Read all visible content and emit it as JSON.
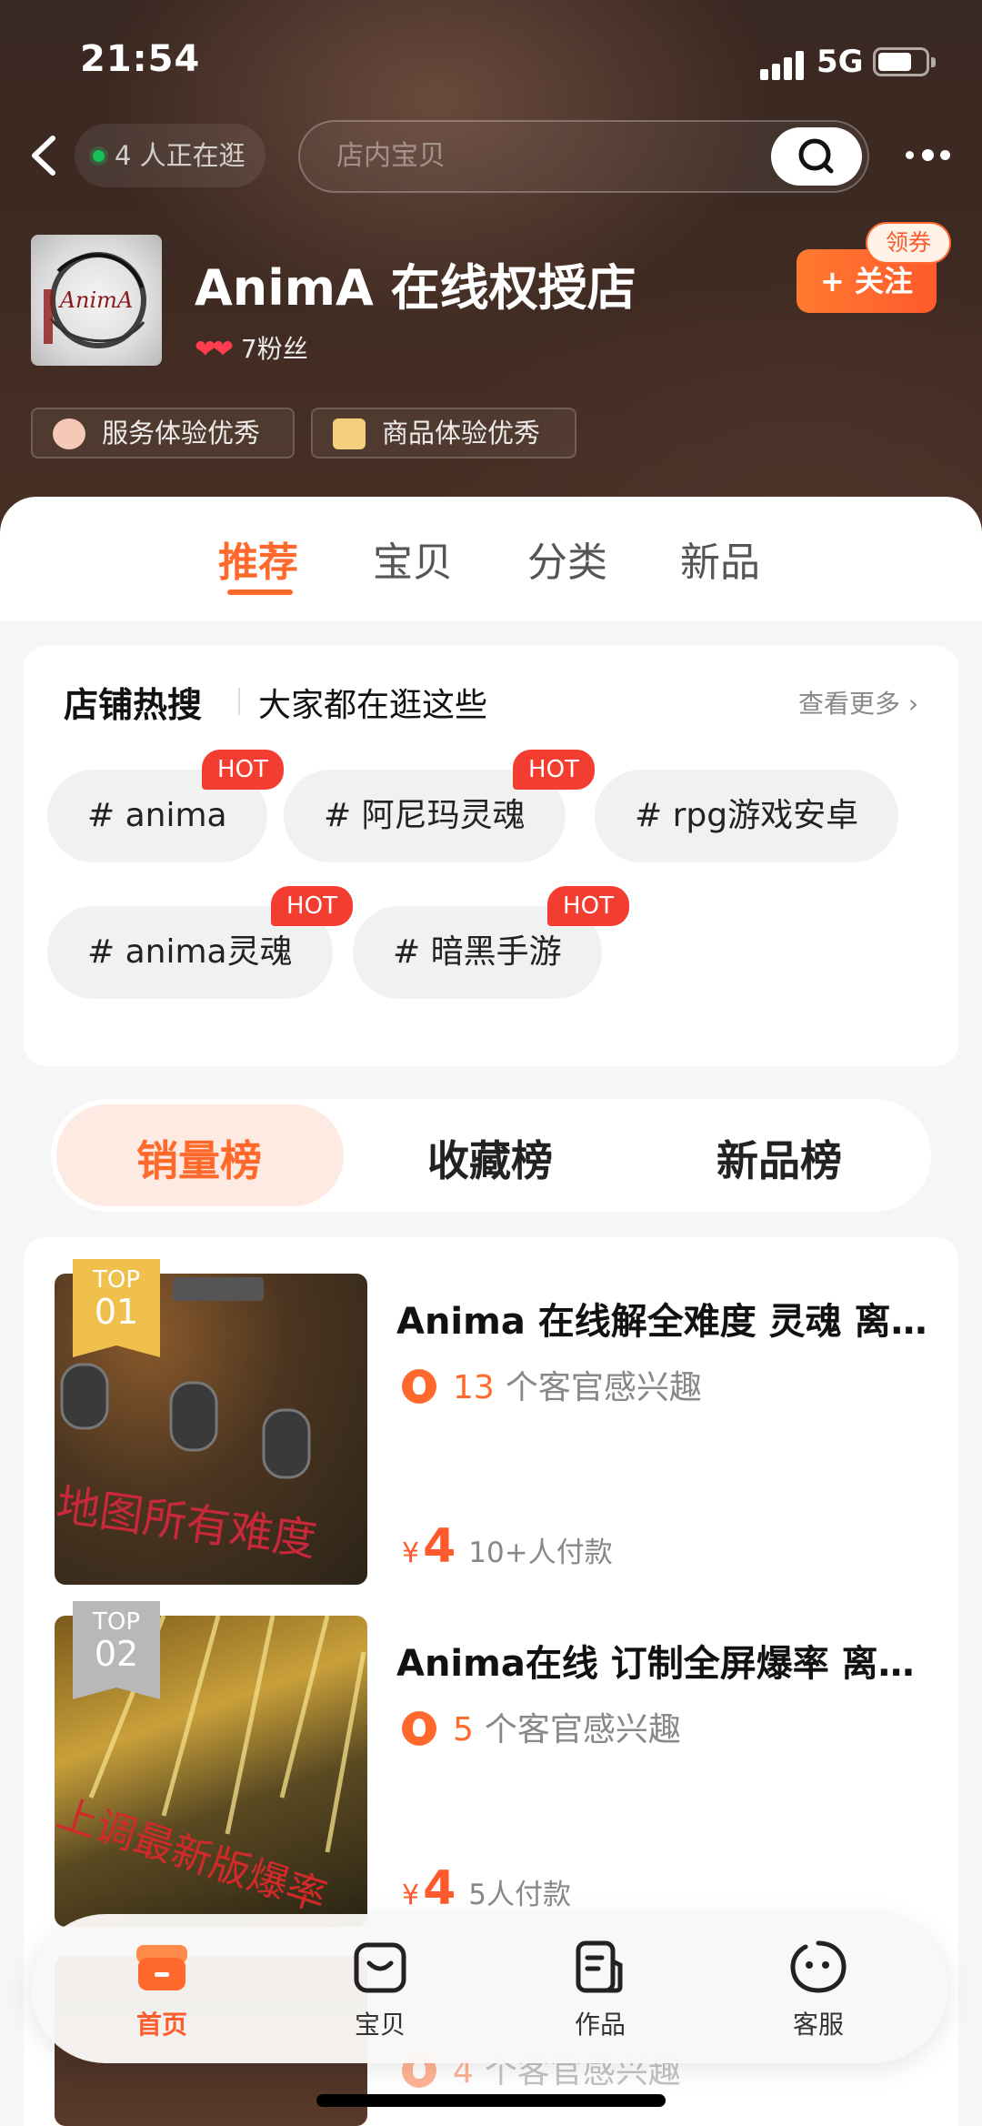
{
  "status_bar": {
    "time": "21:54",
    "network": "5G"
  },
  "header": {
    "browsing_count": "4 人正在逛",
    "search_placeholder": "店内宝贝",
    "logo_text": "AnimA",
    "shop_name": "AnimA 在线权授店",
    "fans": "7粉丝",
    "follow_label": "+ 关注",
    "coupon_label": "领券",
    "badges": [
      "服务体验优秀",
      "商品体验优秀"
    ]
  },
  "tabs": [
    "推荐",
    "宝贝",
    "分类",
    "新品"
  ],
  "hot_search": {
    "title": "店铺热搜",
    "subtitle": "大家都在逛这些",
    "see_more": "查看更多",
    "hot_label": "HOT",
    "chips": [
      "# anima",
      "# 阿尼玛灵魂",
      "# rpg游戏安卓",
      "# anima灵魂",
      "# 暗黑手游"
    ]
  },
  "ranking_tabs": [
    "销量榜",
    "收藏榜",
    "新品榜"
  ],
  "products": [
    {
      "rank_top": "TOP",
      "rank_no": "01",
      "title": "Anima 在线解全难度 灵魂 离线版",
      "interest_num": "13",
      "interest_text": "个客官感兴趣",
      "price_symbol": "¥",
      "price": "4",
      "paid": "10+人付款",
      "image_text": "地图所有难度"
    },
    {
      "rank_top": "TOP",
      "rank_no": "02",
      "title": "Anima在线 订制全屏爆率 离线版",
      "interest_num": "5",
      "interest_text": "个客官感兴趣",
      "price_symbol": "¥",
      "price": "4",
      "paid": "5人付款",
      "image_text": "上调最新版爆率"
    },
    {
      "interest_num": "4",
      "interest_text": "个客官感兴趣"
    }
  ],
  "bottom_nav": [
    "首页",
    "宝贝",
    "作品",
    "客服"
  ],
  "colors": {
    "accent": "#ff6a2c",
    "hot": "#f43d31",
    "header_bg": "#3d2a22",
    "gold": "#f0c04d",
    "silver": "#b8b8b8"
  }
}
